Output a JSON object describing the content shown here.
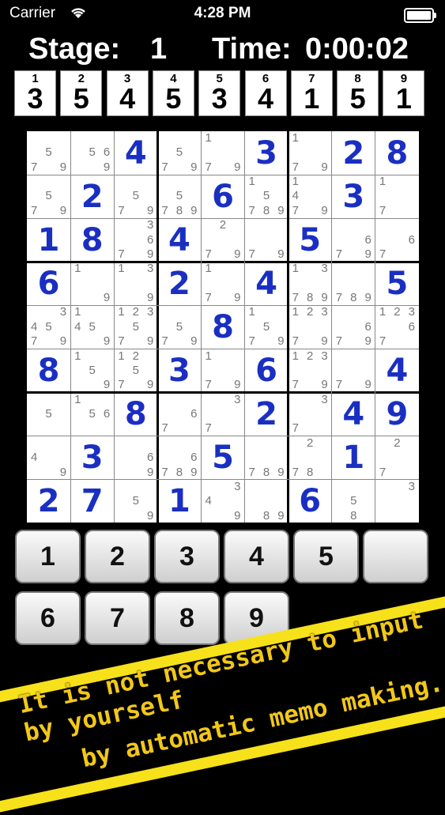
{
  "status_bar": {
    "carrier": "Carrier",
    "time": "4:28 PM"
  },
  "header": {
    "stage_label": "Stage:",
    "stage_value": "1",
    "time_label": "Time:",
    "time_value": "0:00:02"
  },
  "digit_counts": [
    {
      "digit": "1",
      "count": "3"
    },
    {
      "digit": "2",
      "count": "5"
    },
    {
      "digit": "3",
      "count": "4"
    },
    {
      "digit": "4",
      "count": "5"
    },
    {
      "digit": "5",
      "count": "3"
    },
    {
      "digit": "6",
      "count": "4"
    },
    {
      "digit": "7",
      "count": "1"
    },
    {
      "digit": "8",
      "count": "5"
    },
    {
      "digit": "9",
      "count": "1"
    }
  ],
  "grid": {
    "values": [
      [
        "",
        "",
        "4",
        "",
        "",
        "3",
        "",
        "2",
        "8"
      ],
      [
        "",
        "2",
        "",
        "",
        "6",
        "",
        "",
        "3",
        ""
      ],
      [
        "1",
        "8",
        "",
        "4",
        "",
        "",
        "5",
        "",
        ""
      ],
      [
        "6",
        "",
        "",
        "2",
        "",
        "4",
        "",
        "",
        "5"
      ],
      [
        "",
        "",
        "",
        "",
        "8",
        "",
        "",
        "",
        ""
      ],
      [
        "8",
        "",
        "",
        "3",
        "",
        "6",
        "",
        "",
        "4"
      ],
      [
        "",
        "",
        "8",
        "",
        "",
        "2",
        "",
        "4",
        "9"
      ],
      [
        "",
        "3",
        "",
        "",
        "5",
        "",
        "",
        "1",
        ""
      ],
      [
        "2",
        "7",
        "",
        "1",
        "",
        "",
        "6",
        "",
        ""
      ]
    ],
    "memos": [
      [
        "579",
        "569",
        "",
        "579",
        "179",
        "",
        "179",
        "",
        ""
      ],
      [
        "579",
        "",
        "579",
        "5789",
        "",
        "15789",
        "1479",
        "",
        "17"
      ],
      [
        "",
        "",
        "3679",
        "",
        "279",
        "79",
        "",
        "679",
        "67"
      ],
      [
        "",
        "19",
        "139",
        "",
        "179",
        "",
        "13789",
        "789",
        ""
      ],
      [
        "34579",
        "1459",
        "123579",
        "579",
        "",
        "1579",
        "12379",
        "679",
        "12367"
      ],
      [
        "",
        "159",
        "12579",
        "",
        "179",
        "",
        "12379",
        "79",
        ""
      ],
      [
        "5",
        "156",
        "",
        "67",
        "37",
        "",
        "37",
        "",
        ""
      ],
      [
        "49",
        "",
        "69",
        "6789",
        "",
        "789",
        "278",
        "",
        "27"
      ],
      [
        "",
        "",
        "59",
        "",
        "349",
        "89",
        "",
        "58",
        "3"
      ]
    ]
  },
  "keypad": [
    {
      "label": "1"
    },
    {
      "label": "2"
    },
    {
      "label": "3"
    },
    {
      "label": "4"
    },
    {
      "label": "5"
    },
    {
      "label": ""
    },
    {
      "label": "6"
    },
    {
      "label": "7"
    },
    {
      "label": "8"
    },
    {
      "label": "9"
    }
  ],
  "promo": {
    "line1": "It is not necessary to input by yourself",
    "line2": "by automatic memo making.",
    "colors": {
      "banner": "#f7e11a",
      "text": "#f2c817"
    }
  }
}
